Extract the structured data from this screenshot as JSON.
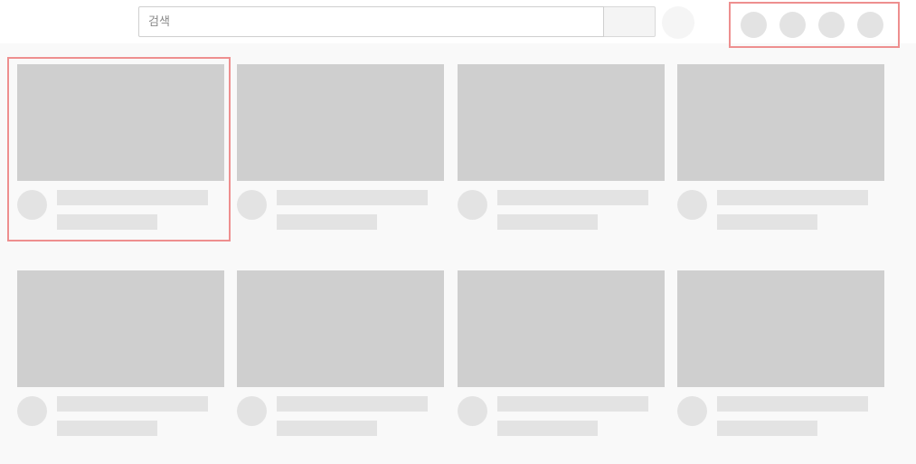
{
  "search": {
    "placeholder": "검색",
    "value": ""
  },
  "header_actions_count": 4,
  "grid": {
    "rows": 2,
    "columns": 4,
    "loading_placeholder": true
  },
  "colors": {
    "highlight": "#ee8f8f",
    "skeleton_thumb": "#cfcfcf",
    "skeleton_line": "#e3e3e3",
    "background": "#f9f9f9"
  }
}
